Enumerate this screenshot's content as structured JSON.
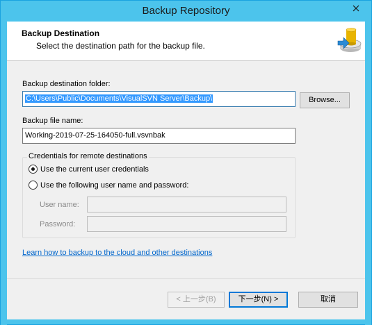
{
  "window": {
    "title": "Backup Repository",
    "close_icon": "close-icon"
  },
  "header": {
    "title": "Backup Destination",
    "subtitle": "Select the destination path for the backup file.",
    "icon": "backup-database-icon"
  },
  "destination": {
    "label": "Backup destination folder:",
    "value": "C:\\Users\\Public\\Documents\\VisualSVN Server\\Backup\\",
    "browse_label": "Browse..."
  },
  "filename": {
    "label": "Backup file name:",
    "value": "Working-2019-07-25-164050-full.vsvnbak"
  },
  "credentials": {
    "legend": "Credentials for remote destinations",
    "option_current": "Use the current user credentials",
    "option_custom": "Use the following user name and password:",
    "username_label": "User name:",
    "username_value": "",
    "password_label": "Password:",
    "password_value": ""
  },
  "link": {
    "text": "Learn how to backup to the cloud and other destinations"
  },
  "footer": {
    "back_label": "< 上一步(B)",
    "next_label": "下一步(N) >",
    "cancel_label": "取消"
  },
  "colors": {
    "titlebar": "#4cc4ec",
    "accent": "#0078d7",
    "selection": "#3399ff",
    "link": "#0066cc"
  }
}
